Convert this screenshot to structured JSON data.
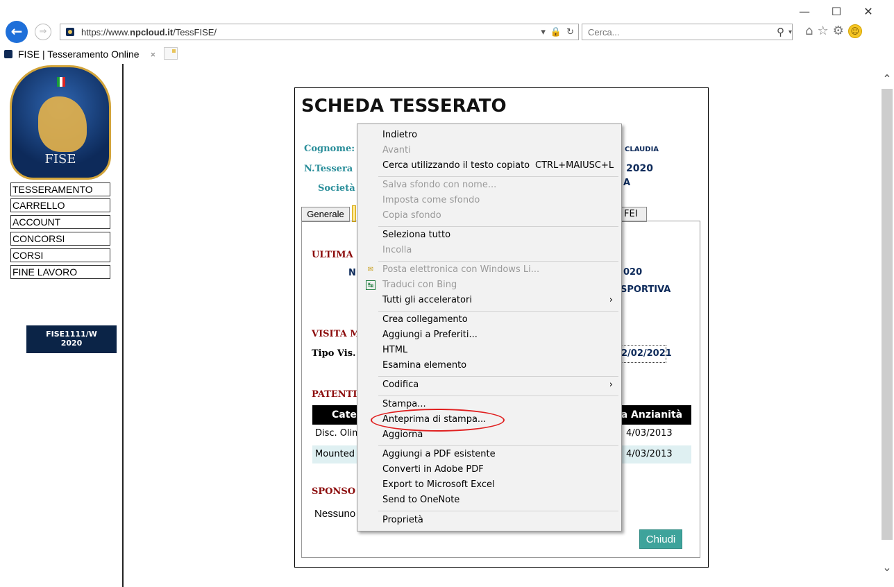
{
  "browser": {
    "url_prefix": "https://www.",
    "url_domain": "npcloud.it",
    "url_path": "/TessFISE/",
    "search_placeholder": "Cerca...",
    "tab_title": "FISE | Tesseramento Online",
    "tab_close": "×",
    "window_controls": [
      "—",
      "☐",
      "✕"
    ]
  },
  "sidebar": {
    "logo_text": "FISE",
    "items": [
      "TESSERAMENTO",
      "CARRELLO",
      "ACCOUNT",
      "CONCORSI",
      "CORSI",
      "FINE LAVORO"
    ],
    "badge_line1": "FISE1111/W",
    "badge_line2": "2020"
  },
  "card": {
    "title": "SCHEDA TESSERATO",
    "cognome_label": "Cognome:",
    "nome_value": "CLAUDIA",
    "tessera_label": "N.Tessera",
    "year_value": "2020",
    "societa_label": "Società",
    "societa_value": "A",
    "tab_generale": "Generale",
    "tab_fei": "FEI",
    "ultima_heading": "ULTIMA",
    "ultima_n": "N",
    "ultima_year": "020",
    "sportiva": "SPORTIVA",
    "visita_heading": "VISITA M",
    "tipo_vis_label": "Tipo Vis.",
    "visit_date": "2/02/2021",
    "patenti_heading": "PATENTI",
    "table_head_left": "Categ",
    "table_head_right": "ta Anzianità",
    "rows": [
      {
        "left": "Disc. Olim",
        "right": "4/03/2013"
      },
      {
        "left": "Mounted",
        "right": "4/03/2013"
      }
    ],
    "sponsor_heading": "SPONSO",
    "sponsor_value": "Nessuno",
    "close_button": "Chiudi"
  },
  "context_menu": {
    "items": [
      {
        "label": "Indietro",
        "disabled": false
      },
      {
        "label": "Avanti",
        "disabled": true
      },
      {
        "label": "Cerca utilizzando il testo copiato",
        "shortcut": "CTRL+MAIUSC+L",
        "disabled": false
      },
      {
        "label": "Salva sfondo con nome...",
        "disabled": true
      },
      {
        "label": "Imposta come sfondo",
        "disabled": true
      },
      {
        "label": "Copia sfondo",
        "disabled": true
      },
      {
        "label": "Seleziona tutto",
        "disabled": false
      },
      {
        "label": "Incolla",
        "disabled": true
      },
      {
        "label": "Posta elettronica con Windows Li...",
        "disabled": true
      },
      {
        "label": "Traduci con Bing",
        "disabled": true
      },
      {
        "label": "Tutti gli acceleratori",
        "disabled": false,
        "submenu": true
      },
      {
        "label": "Crea collegamento",
        "disabled": false
      },
      {
        "label": "Aggiungi a Preferiti...",
        "disabled": false
      },
      {
        "label": "HTML",
        "disabled": false
      },
      {
        "label": "Esamina elemento",
        "disabled": false
      },
      {
        "label": "Codifica",
        "disabled": false,
        "submenu": true
      },
      {
        "label": "Stampa...",
        "disabled": false
      },
      {
        "label": "Anteprima di stampa...",
        "disabled": false,
        "highlighted": true
      },
      {
        "label": "Aggiorna",
        "disabled": false
      },
      {
        "label": "Aggiungi a PDF esistente",
        "disabled": false
      },
      {
        "label": "Converti in Adobe PDF",
        "disabled": false
      },
      {
        "label": "Export to Microsoft Excel",
        "disabled": false
      },
      {
        "label": "Send to OneNote",
        "disabled": false
      },
      {
        "label": "Proprietà",
        "disabled": false
      }
    ],
    "submenu_arrow": "›",
    "highlight_color": "#e02020"
  }
}
